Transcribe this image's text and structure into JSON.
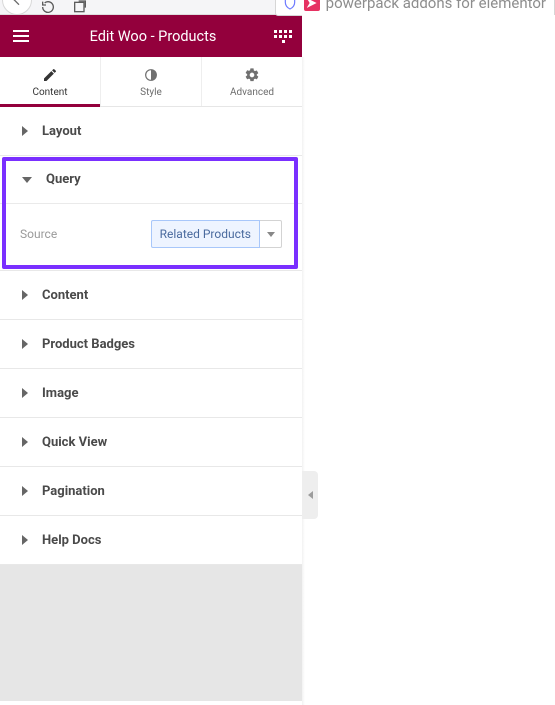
{
  "browser": {
    "address_text": "powerpack addons for elementor"
  },
  "header": {
    "title": "Edit Woo - Products"
  },
  "tabs": {
    "content": "Content",
    "style": "Style",
    "advanced": "Advanced"
  },
  "sections": {
    "layout": "Layout",
    "query": "Query",
    "content": "Content",
    "product_badges": "Product Badges",
    "image": "Image",
    "quick_view": "Quick View",
    "pagination": "Pagination",
    "help_docs": "Help Docs"
  },
  "query": {
    "source_label": "Source",
    "source_value": "Related Products"
  },
  "icons": {
    "back": "back-icon",
    "forward": "forward-icon",
    "reload": "reload-icon",
    "newtab": "newtab-icon",
    "shield": "shield-icon",
    "hamburger": "hamburger-icon",
    "apps": "apps-icon",
    "pencil": "pencil-icon",
    "halfcircle": "half-circle-icon",
    "gear": "gear-icon"
  },
  "colors": {
    "brand": "#93003c",
    "highlight": "#7a2fff"
  }
}
